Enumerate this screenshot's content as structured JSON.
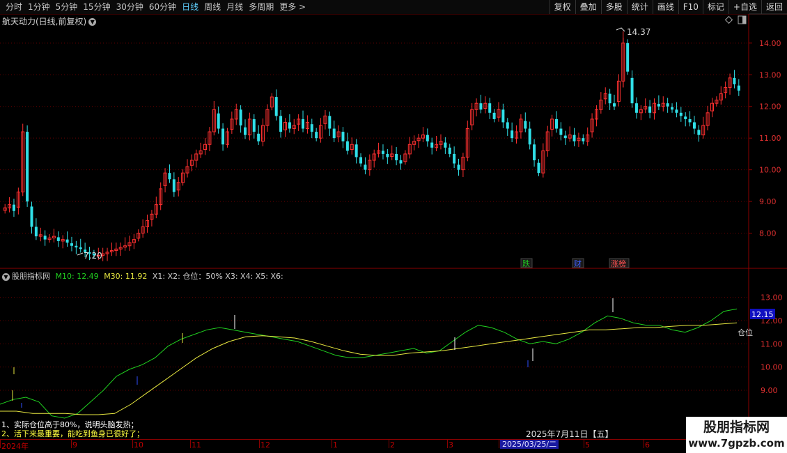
{
  "toolbar": {
    "periods": [
      "分时",
      "1分钟",
      "5分钟",
      "15分钟",
      "30分钟",
      "60分钟",
      "日线",
      "周线",
      "月线",
      "多周期",
      "更多 >"
    ],
    "active_index": 6,
    "buttons": [
      "复权",
      "叠加",
      "多股",
      "统计",
      "画线",
      "F10",
      "标记",
      "+自选",
      "返回"
    ]
  },
  "main_chart": {
    "title": "航天动力(日线,前复权)",
    "high_label": "14.37",
    "low_label": "7.20",
    "events": [
      {
        "label": "跌",
        "color": "#20c020"
      },
      {
        "label": "财",
        "color": "#4060ff"
      },
      {
        "label": "涨榜",
        "color": "#ff5050"
      }
    ]
  },
  "indicator": {
    "name": "股朋指标网",
    "m10": "M10: 12.49",
    "m30": "M30: 11.92",
    "rest": "X1: X2: 仓位：50% X3: X4: X5: X6:",
    "current_badge": "12.15",
    "side_label": "仓位",
    "notes": [
      "1、实际仓位高于80%，说明头脑发热；",
      "2、活下来最重要，能吃到鱼身已很好了；"
    ]
  },
  "time_axis": {
    "labels": [
      "2024年",
      "9",
      "10",
      "11",
      "12",
      "1",
      "2",
      "3",
      "2025/03/25/二",
      "5",
      "6"
    ],
    "hover_date": "2025年7月11日【五】"
  },
  "watermark": {
    "name": "股朋指标网",
    "url": "www.7gpzb.com"
  },
  "chart_data": [
    {
      "type": "candlestick",
      "title": "航天动力(日线,前复权)",
      "ylim": [
        7.0,
        14.7
      ],
      "yticks": [
        "14.00",
        "13.00",
        "12.00",
        "11.00",
        "10.00",
        "9.00",
        "8.00"
      ],
      "closes": [
        8.8,
        8.9,
        8.7,
        9.3,
        11.2,
        9.0,
        8.2,
        7.9,
        7.95,
        7.8,
        7.85,
        7.9,
        7.75,
        7.8,
        7.7,
        7.6,
        7.55,
        7.5,
        7.4,
        7.35,
        7.3,
        7.3,
        7.35,
        7.4,
        7.45,
        7.5,
        7.55,
        7.6,
        7.7,
        7.8,
        8.0,
        8.2,
        8.4,
        8.6,
        8.9,
        9.4,
        9.9,
        9.7,
        9.3,
        9.6,
        9.9,
        10.1,
        10.3,
        10.5,
        10.6,
        10.8,
        11.2,
        11.9,
        11.3,
        10.8,
        11.2,
        11.6,
        11.9,
        11.4,
        11.1,
        11.6,
        11.2,
        10.9,
        11.4,
        11.9,
        12.3,
        11.7,
        11.2,
        11.5,
        11.3,
        11.4,
        11.6,
        11.3,
        11.5,
        11.2,
        11.0,
        11.4,
        11.7,
        11.3,
        11.0,
        11.2,
        10.9,
        10.6,
        10.8,
        10.4,
        10.2,
        10.0,
        10.3,
        10.5,
        10.6,
        10.5,
        10.4,
        10.5,
        10.3,
        10.2,
        10.5,
        10.8,
        10.9,
        11.0,
        11.1,
        10.9,
        10.7,
        10.8,
        10.9,
        10.7,
        10.5,
        10.2,
        10.0,
        10.4,
        11.3,
        11.9,
        12.1,
        11.9,
        12.1,
        11.8,
        11.6,
        11.9,
        11.5,
        11.3,
        11.0,
        11.2,
        11.6,
        11.3,
        10.8,
        10.3,
        9.9,
        10.6,
        11.2,
        11.6,
        11.3,
        11.1,
        11.0,
        11.1,
        10.9,
        11.0,
        10.9,
        11.1,
        11.6,
        11.9,
        12.2,
        12.4,
        12.1,
        12.0,
        12.8,
        14.0,
        13.1,
        12.1,
        11.8,
        11.9,
        12.0,
        11.8,
        12.1,
        12.0,
        12.1,
        12.0,
        11.9,
        11.8,
        11.7,
        11.6,
        11.5,
        11.3,
        11.1,
        11.4,
        11.8,
        12.1,
        12.2,
        12.4,
        12.6,
        12.9,
        12.7,
        12.5
      ],
      "high": 14.37,
      "low": 7.2
    },
    {
      "type": "line",
      "name": "股朋指标网",
      "ylim": [
        7.8,
        13.8
      ],
      "yticks": [
        "13.00",
        "12.00",
        "11.00",
        "10.00",
        "9.00"
      ],
      "series": [
        {
          "name": "M10",
          "color": "#20d020",
          "values": [
            8.4,
            8.6,
            8.7,
            8.5,
            7.9,
            7.8,
            8.0,
            8.5,
            9.0,
            9.6,
            9.9,
            10.1,
            10.4,
            10.9,
            11.2,
            11.4,
            11.6,
            11.7,
            11.6,
            11.5,
            11.4,
            11.3,
            11.2,
            11.1,
            10.9,
            10.7,
            10.5,
            10.4,
            10.4,
            10.5,
            10.6,
            10.7,
            10.8,
            10.6,
            10.7,
            11.1,
            11.5,
            11.8,
            11.7,
            11.5,
            11.2,
            11.0,
            11.1,
            11.0,
            11.2,
            11.5,
            11.9,
            12.2,
            12.1,
            11.9,
            11.8,
            11.8,
            11.6,
            11.5,
            11.7,
            12.0,
            12.4,
            12.5
          ]
        },
        {
          "name": "M30",
          "color": "#e8e840",
          "values": [
            8.1,
            8.1,
            8.0,
            8.0,
            8.0,
            7.95,
            7.95,
            8.0,
            8.4,
            8.9,
            9.4,
            9.9,
            10.4,
            10.8,
            11.1,
            11.3,
            11.35,
            11.3,
            11.25,
            11.1,
            10.9,
            10.7,
            10.55,
            10.5,
            10.5,
            10.6,
            10.65,
            10.7,
            10.8,
            10.9,
            11.0,
            11.1,
            11.2,
            11.3,
            11.4,
            11.5,
            11.6,
            11.6,
            11.65,
            11.7,
            11.7,
            11.75,
            11.8,
            11.8,
            11.85,
            11.9
          ]
        }
      ]
    }
  ]
}
